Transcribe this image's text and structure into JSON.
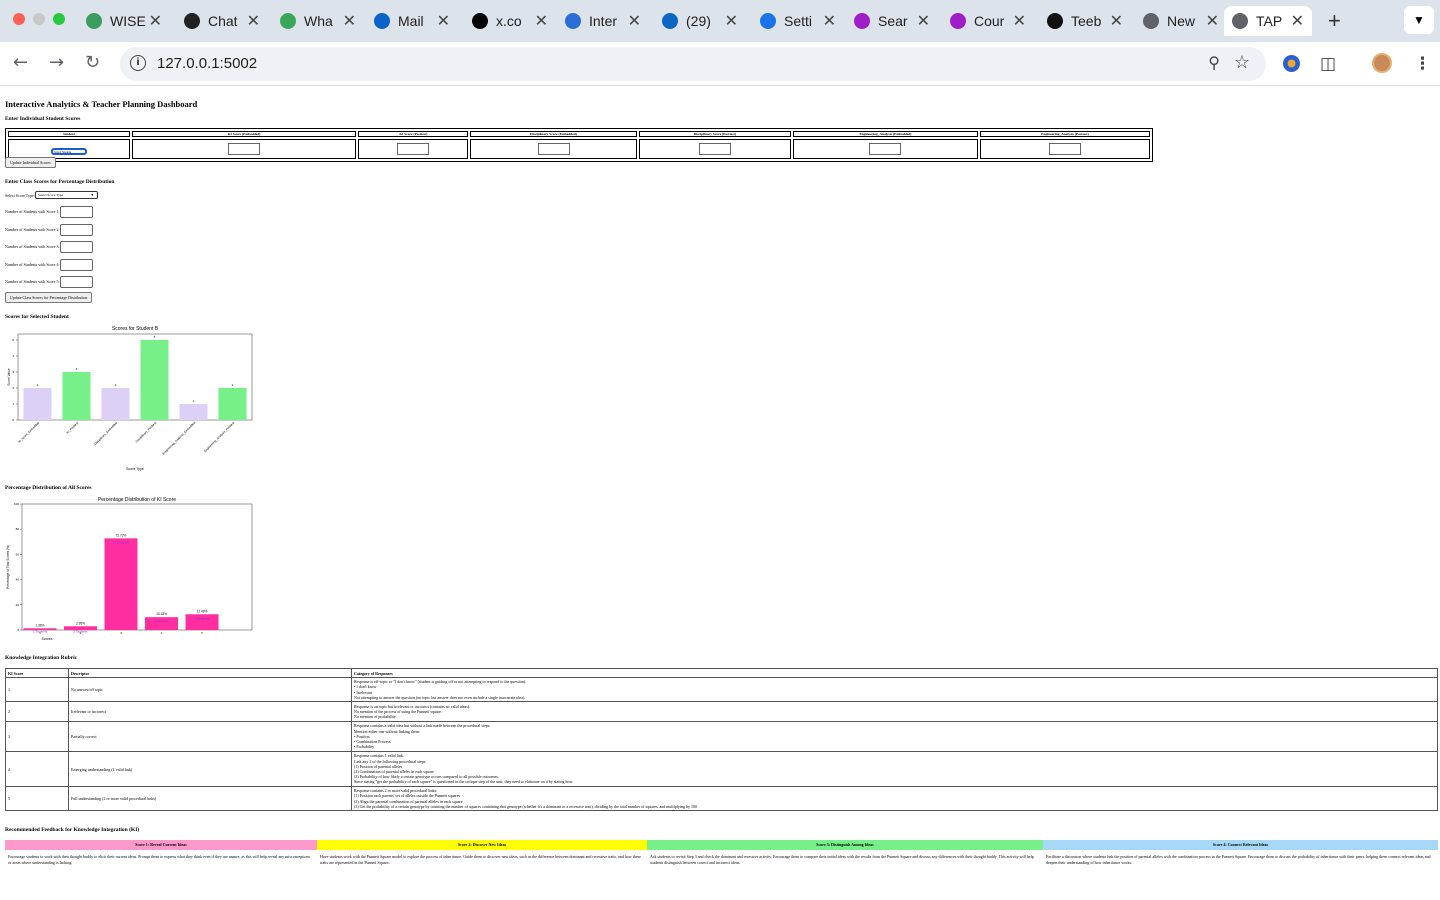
{
  "browser": {
    "tabs": [
      {
        "title": "WISE",
        "fav_color": "#3a9d5d"
      },
      {
        "title": "Chat",
        "fav_color": "#222222"
      },
      {
        "title": "Wha",
        "fav_color": "#3aa65a"
      },
      {
        "title": "Mail",
        "fav_color": "#0a64c8"
      },
      {
        "title": "x.co",
        "fav_color": "#000000"
      },
      {
        "title": "Inter",
        "fav_color": "#2a6fd6"
      },
      {
        "title": "(29)",
        "fav_color": "#0a66c2"
      },
      {
        "title": "Setti",
        "fav_color": "#1a73e8"
      },
      {
        "title": "Sear",
        "fav_color": "#a01ec8"
      },
      {
        "title": "Cour",
        "fav_color": "#a01ec8"
      },
      {
        "title": "Teeb",
        "fav_color": "#111111"
      },
      {
        "title": "New",
        "fav_color": "#5f6368"
      },
      {
        "title": "TAP",
        "fav_color": "#5f6368",
        "active": true
      }
    ],
    "url": "127.0.0.1:5002"
  },
  "page": {
    "title": "Interactive Analytics & Teacher Planning Dashboard",
    "individual": {
      "heading": "Enter Individual Student Scores",
      "columns": [
        "Student",
        "KI Score (Embedded)",
        "KI Score (Posttest)",
        "Disciplinary Score (Embedded)",
        "Disciplinary Score (Posttest)",
        "Engineering_Analysis (Embedded)",
        "Engineering_Analysis (Posttest)"
      ],
      "student_select": "Select Student",
      "update_button": "Update Individual Scores"
    },
    "class_scores": {
      "heading": "Enter Class Scores for Percentage Distribution",
      "select_label": "Select Score Type:",
      "select_value": "Select Score Type",
      "labels": [
        "Number of Students with Score 1:",
        "Number of Students with Score 2:",
        "Number of Students with Score 3:",
        "Number of Students with Score 4:",
        "Number of Students with Score 5:"
      ],
      "update_button": "Update Class Scores for Percentage Distribution"
    },
    "chart1_heading": "Scores for Selected Student",
    "chart2_heading": "Percentage Distribution of All Scores"
  },
  "chart_data": [
    {
      "type": "bar",
      "title": "Scores for Student B",
      "xlabel": "Score Type",
      "ylabel": "Score Value",
      "categories": [
        "KI_Score_Embedded",
        "KI_Posttest",
        "Disciplinary_Embedded",
        "Disciplinary_Posttest",
        "Engineering_Analysis_Embedded",
        "Engineering_Analysis_Posttest"
      ],
      "values": [
        2,
        3,
        2,
        5,
        1,
        2
      ],
      "ylim": [
        0,
        5
      ],
      "yticks": [
        0,
        1,
        2,
        3,
        4,
        5
      ],
      "colors": [
        "#ddd0f7",
        "#78f08a",
        "#ddd0f7",
        "#78f08a",
        "#ddd0f7",
        "#78f08a"
      ]
    },
    {
      "type": "bar",
      "title": "Percentage Distribution of KI Score",
      "xlabel": "Scores",
      "ylabel": "Percentage of Total Scores (%)",
      "categories": [
        "1",
        "2",
        "3",
        "4",
        "5"
      ],
      "values": [
        1.36,
        2.95,
        72.73,
        10.18,
        12.49
      ],
      "value_labels": [
        "1.36%",
        "2.95%",
        "72.73%",
        "10.18%",
        "12.49%"
      ],
      "inner_labels": [
        "1 Students",
        "2 Students",
        "16 Students",
        "3 Students",
        "3 Students"
      ],
      "ylim": [
        0,
        100
      ],
      "yticks": [
        0,
        20,
        40,
        60,
        80,
        100
      ],
      "bar_color": "#ff2ea0",
      "inner_label_color": "#8a2be2"
    }
  ],
  "rubric": {
    "heading": "Knowledge Integration Rubric",
    "columns": [
      "KI Score",
      "Descriptor",
      "Category of Responses"
    ],
    "rows": [
      {
        "score": "1",
        "descriptor": "No answer/off topic",
        "desc": "Response is off-topic or \"I don't know\" (student is guiding off or not attempting to respond to the question).\n• I don't know\n• Irrelevant\nNot attempting to answer the question (no topic but answer does not even include a single inaccurate idea)."
      },
      {
        "score": "2",
        "descriptor": "Irrelevant or incorrect",
        "desc": "Response is on topic but irrelevant or incorrect (contains no valid ideas).\nNo mention of the process of using the Punnett square.\nNo mention of probability."
      },
      {
        "score": "3",
        "descriptor": "Partially correct",
        "desc": "Response contains a valid idea but without a link made between the procedural steps.\nMention either one without linking them:\n• Position\n• Combination Process\n• Probability"
      },
      {
        "score": "4",
        "descriptor": "Emerging understanding (1 valid link)",
        "desc": "Response contains 1 valid link.\nLink any 2 of the following procedural steps:\n(1) Position of parental alleles\n(2) Combination of parental alleles in each square\n(3) Probability of how likely a certain genotype occurs compared to all possible outcomes.\nSince stating \"get the probability of each square\" is questioned in the critique step of the unit; they need to elaborate on it by stating how."
      },
      {
        "score": "5",
        "descriptor": "Full understanding (2 or more valid procedural links)",
        "desc": "Response contains 2 or more valid procedural links:\n(1) Position each parents' set of alleles outside the Punnett squares\n(2) Align the parental combination of parental alleles in each square\n(3) Get the probability of a certain genotype by counting the number of squares containing that genotype (whether it's a dominant or a recessive trait), dividing by the total number of squares, and multiplying by 100"
      }
    ]
  },
  "feedback": {
    "heading": "Recommended Feedback for Knowledge Integration (KI)",
    "cards": [
      {
        "title": "Score 1: Reveal Current Ideas",
        "color": "#ff99cc",
        "text": "Encourage students to work with their thought buddy to elicit their current ideas. Prompt them to express what they think even if they are unsure, as this will help reveal any misconceptions or areas where understanding is lacking."
      },
      {
        "title": "Score 2: Discover New Ideas",
        "color": "#ffff00",
        "text": "Have students work with the Punnett Square model to explore the process of inheritance. Guide them to discover new ideas, such as the difference between dominant and recessive traits, and how these traits are represented in the Punnett Square."
      },
      {
        "title": "Score 3: Distinguish Among Ideas",
        "color": "#78f08a",
        "text": "Ask students to revisit Step 3 and check the dominant and recessive activity. Encourage them to compare their initial ideas with the results from the Punnett Square and discuss any differences with their thought buddy. This activity will help students distinguish between correct and incorrect ideas."
      },
      {
        "title": "Score 4: Connect Relevant Ideas",
        "color": "#a8d8f8",
        "text": "Facilitate a discussion where students link the position of parental alleles with the combination process in the Punnett Square. Encourage them to discuss the probability of inheritance with their peers, helping them connect relevant ideas and deepen their understanding of how inheritance works."
      }
    ]
  }
}
